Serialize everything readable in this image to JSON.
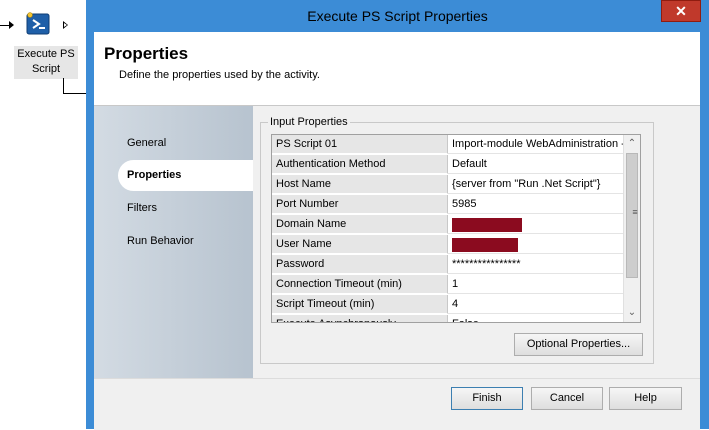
{
  "canvas": {
    "activity_label": "Execute PS\nScript",
    "activity_icon": "powershell-icon"
  },
  "dialog": {
    "title": "Execute PS Script Properties",
    "close_glyph": "✕",
    "header": {
      "title": "Properties",
      "subtitle": "Define the properties used by the activity."
    },
    "nav": {
      "items": [
        {
          "label": "General"
        },
        {
          "label": "Properties"
        },
        {
          "label": "Filters"
        },
        {
          "label": "Run Behavior"
        }
      ],
      "selected": "Properties"
    },
    "input_properties": {
      "label": "Input Properties",
      "rows": [
        {
          "name": "PS Script 01",
          "value": "Import-module WebAdministration -("
        },
        {
          "name": "Authentication Method",
          "value": "Default"
        },
        {
          "name": "Host Name",
          "value": "{server from \"Run .Net Script\"}"
        },
        {
          "name": "Port Number",
          "value": "5985"
        },
        {
          "name": "Domain Name",
          "value": "",
          "redacted": true
        },
        {
          "name": "User Name",
          "value": "",
          "redacted": true
        },
        {
          "name": "Password",
          "value": "****************"
        },
        {
          "name": "Connection Timeout (min)",
          "value": "1"
        },
        {
          "name": "Script Timeout (min)",
          "value": "4"
        },
        {
          "name": "Execute Asynchronously",
          "value": "False"
        }
      ]
    },
    "optional_button": "Optional Properties...",
    "footer": {
      "finish": "Finish",
      "cancel": "Cancel",
      "help": "Help"
    }
  },
  "colors": {
    "titlebar": "#3c8cd6",
    "close": "#c0392b",
    "redaction": "#8b0b1f"
  }
}
